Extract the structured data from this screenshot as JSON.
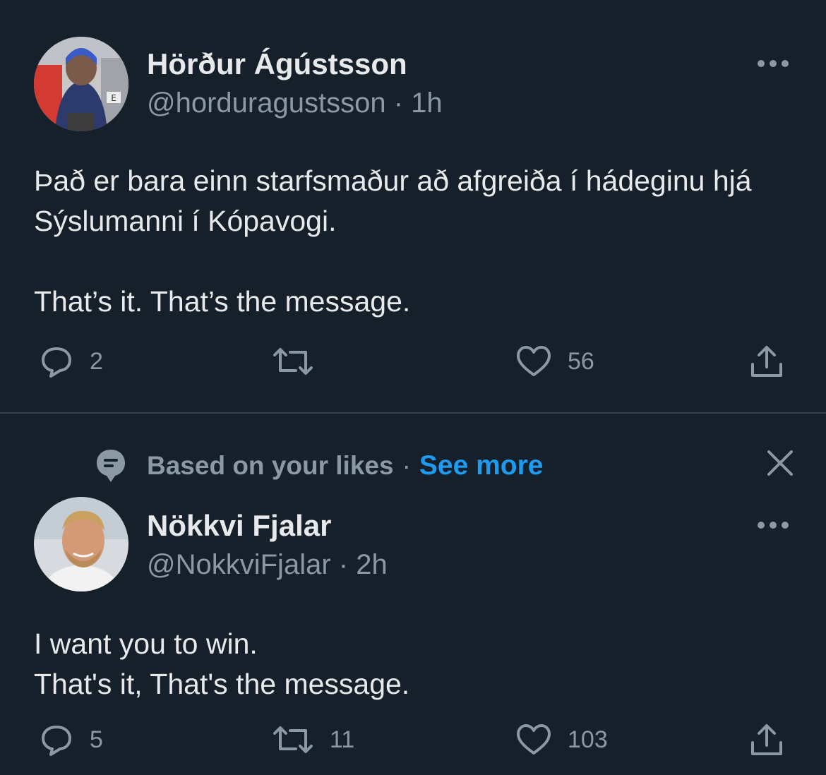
{
  "tweets": [
    {
      "author_name": "Hörður Ágústsson",
      "handle": "@horduragustsson",
      "time": "1h",
      "text_paragraphs": [
        "Það er bara einn starfsmaður að afgreiða í hádeginu hjá Sýslumanni í Kópavogi.",
        "That’s it. That’s the message."
      ],
      "reply_count": "2",
      "retweet_count": "",
      "like_count": "56"
    },
    {
      "author_name": "Nökkvi Fjalar",
      "handle": "@NokkviFjalar",
      "time": "2h",
      "text_paragraphs": [
        "I want you to win.\nThat's it, That's the message."
      ],
      "reply_count": "5",
      "retweet_count": "11",
      "like_count": "103"
    }
  ],
  "social_context": {
    "label": "Based on your likes",
    "separator": "·",
    "link": "See more"
  },
  "meta_separator": " · ",
  "colors": {
    "background": "#15202b",
    "text": "#e7e9ea",
    "secondary": "#8b98a5",
    "link": "#1d9bf0",
    "divider": "#38444d"
  },
  "icons": {
    "more": "more-horizontal-icon",
    "reply": "reply-icon",
    "retweet": "retweet-icon",
    "like": "heart-icon",
    "share": "share-icon",
    "context": "speech-bubble-icon",
    "close": "close-icon"
  }
}
